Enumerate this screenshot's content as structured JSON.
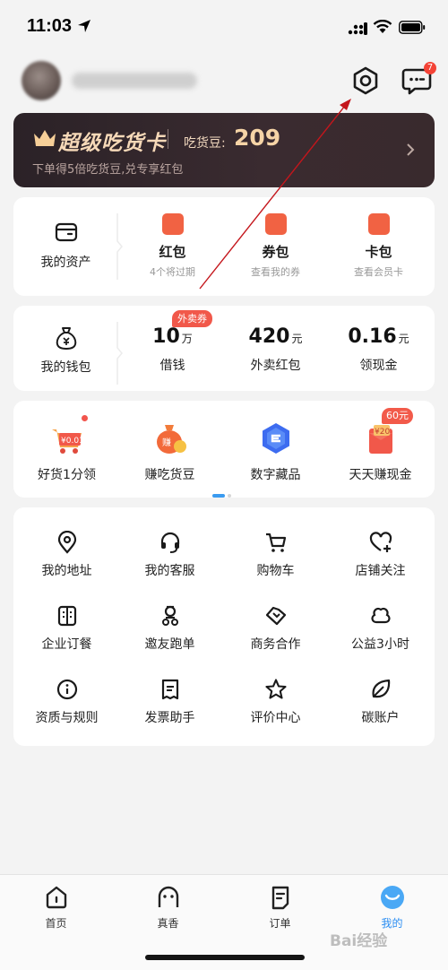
{
  "status": {
    "time": "11:03"
  },
  "header": {
    "message_badge": "7"
  },
  "vip": {
    "title": "超级吃货卡",
    "beans_label": "吃货豆:",
    "beans_value": "209",
    "subtitle": "下单得5倍吃货豆,兑专享红包"
  },
  "assets": {
    "label": "我的资产",
    "items": [
      {
        "title": "红包",
        "desc": "4个将过期",
        "icon_color": "#f16243"
      },
      {
        "title": "券包",
        "desc": "查看我的券",
        "icon_color": "#f16243"
      },
      {
        "title": "卡包",
        "desc": "查看会员卡",
        "icon_color": "#f16243"
      }
    ]
  },
  "wallet": {
    "label": "我的钱包",
    "tag": "外卖券",
    "items": [
      {
        "value": "10",
        "unit": "万",
        "label": "借钱"
      },
      {
        "value": "420",
        "unit": "元",
        "label": "外卖红包"
      },
      {
        "value": "0.16",
        "unit": "元",
        "label": "领现金"
      }
    ]
  },
  "promos": {
    "tag": "60元",
    "items": [
      {
        "label": "好货1分领",
        "icon": "cart-gift-icon"
      },
      {
        "label": "赚吃货豆",
        "icon": "money-bag-icon"
      },
      {
        "label": "数字藏品",
        "icon": "digital-collection-icon"
      },
      {
        "label": "天天赚现金",
        "icon": "cash-envelope-icon"
      }
    ]
  },
  "services": [
    {
      "label": "我的地址",
      "icon": "location-pin-icon"
    },
    {
      "label": "我的客服",
      "icon": "headset-icon"
    },
    {
      "label": "购物车",
      "icon": "shopping-cart-icon"
    },
    {
      "label": "店铺关注",
      "icon": "heart-plus-icon"
    },
    {
      "label": "企业订餐",
      "icon": "building-icon"
    },
    {
      "label": "邀友跑单",
      "icon": "rider-icon"
    },
    {
      "label": "商务合作",
      "icon": "handshake-icon"
    },
    {
      "label": "公益3小时",
      "icon": "charity-icon"
    },
    {
      "label": "资质与规则",
      "icon": "info-icon"
    },
    {
      "label": "发票助手",
      "icon": "invoice-icon"
    },
    {
      "label": "评价中心",
      "icon": "star-icon"
    },
    {
      "label": "碳账户",
      "icon": "leaf-icon"
    }
  ],
  "tabs": [
    {
      "label": "首页",
      "icon": "home-icon"
    },
    {
      "label": "真香",
      "icon": "ghost-icon"
    },
    {
      "label": "订单",
      "icon": "order-icon"
    },
    {
      "label": "我的",
      "icon": "profile-face-icon"
    }
  ],
  "watermark": "Bai经验",
  "colors": {
    "accent": "#2a8df2",
    "red": "#f1584a",
    "vip_gold": "#f6d4a6"
  }
}
